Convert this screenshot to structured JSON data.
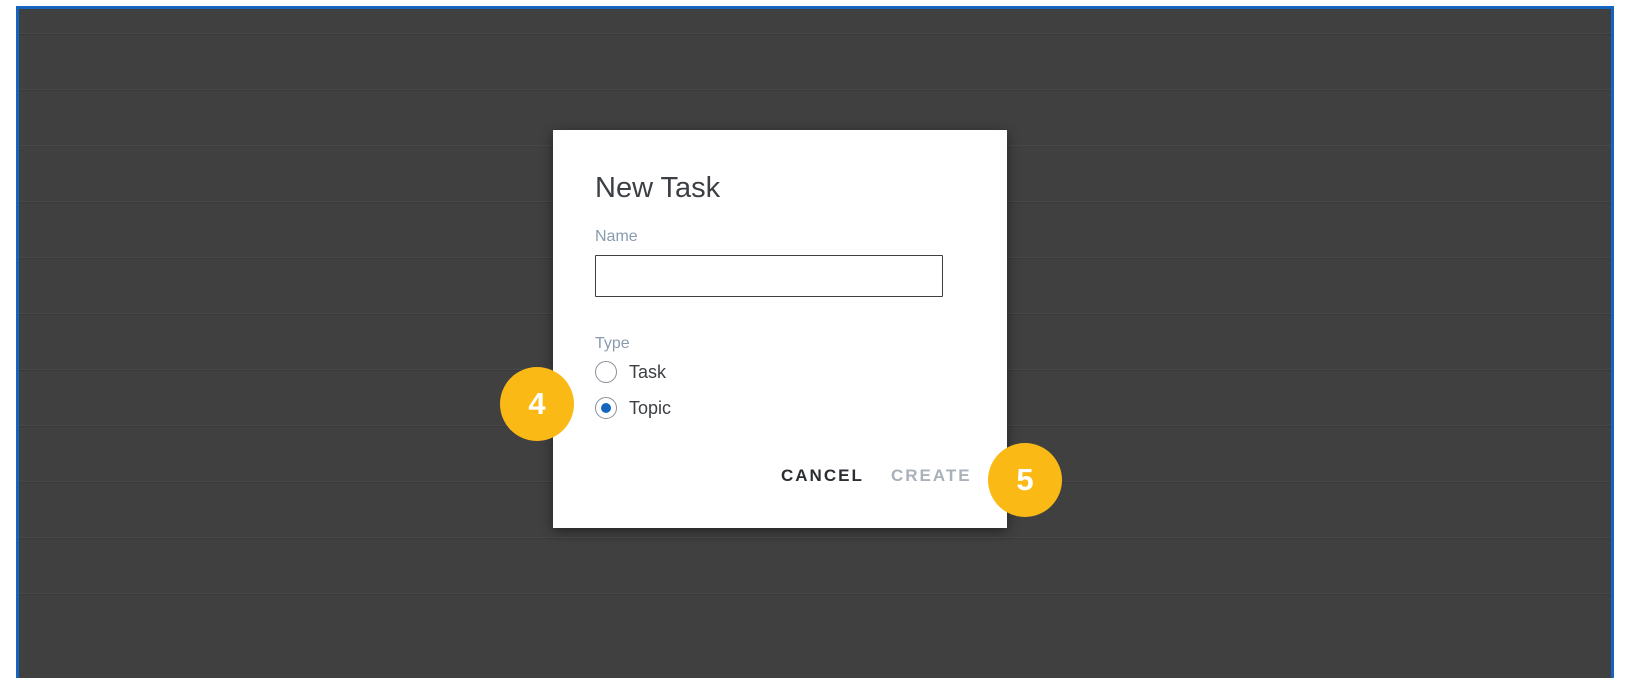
{
  "dialog": {
    "title": "New Task",
    "name_label": "Name",
    "name_value": "",
    "type_label": "Type",
    "options": [
      {
        "label": "Task",
        "selected": false
      },
      {
        "label": "Topic",
        "selected": true
      }
    ],
    "cancel_label": "CANCEL",
    "create_label": "CREATE"
  },
  "badges": [
    {
      "label": "4"
    },
    {
      "label": "5"
    }
  ],
  "colors": {
    "accent": "#1565c0",
    "badge": "#fbb915",
    "overlay": "#404040",
    "disabled_text": "#a9b1ba"
  }
}
